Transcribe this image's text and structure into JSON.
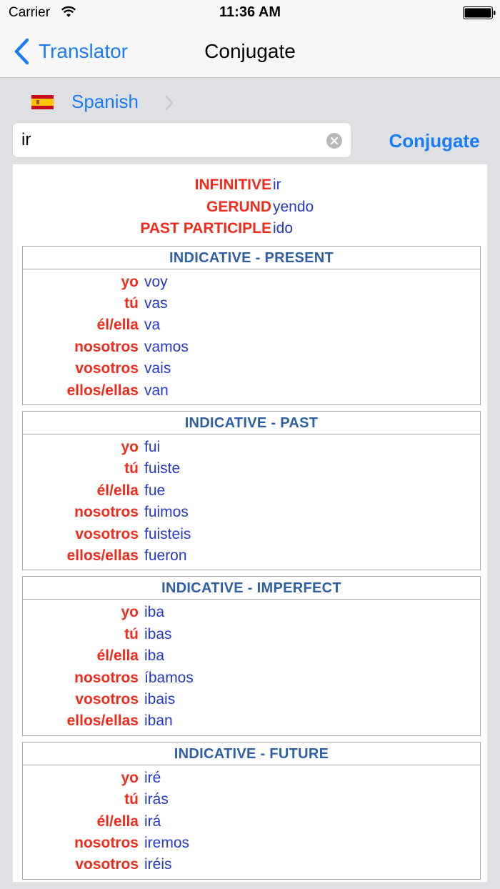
{
  "status": {
    "carrier": "Carrier",
    "time": "11:36 AM"
  },
  "nav": {
    "back_label": "Translator",
    "title": "Conjugate"
  },
  "language": {
    "name": "Spanish"
  },
  "search": {
    "value": "ir",
    "placeholder": ""
  },
  "conjugate_button": "Conjugate",
  "forms": [
    {
      "label": "INFINITIVE",
      "value": "ir"
    },
    {
      "label": "GERUND",
      "value": "yendo"
    },
    {
      "label": "PAST PARTICIPLE",
      "value": "ido"
    }
  ],
  "tenses": [
    {
      "title": "INDICATIVE - PRESENT",
      "rows": [
        {
          "pronoun": "yo",
          "form": "voy"
        },
        {
          "pronoun": "tú",
          "form": "vas"
        },
        {
          "pronoun": "él/ella",
          "form": "va"
        },
        {
          "pronoun": "nosotros",
          "form": "vamos"
        },
        {
          "pronoun": "vosotros",
          "form": "vais"
        },
        {
          "pronoun": "ellos/ellas",
          "form": "van"
        }
      ]
    },
    {
      "title": "INDICATIVE - PAST",
      "rows": [
        {
          "pronoun": "yo",
          "form": "fui"
        },
        {
          "pronoun": "tú",
          "form": "fuiste"
        },
        {
          "pronoun": "él/ella",
          "form": "fue"
        },
        {
          "pronoun": "nosotros",
          "form": "fuimos"
        },
        {
          "pronoun": "vosotros",
          "form": "fuisteis"
        },
        {
          "pronoun": "ellos/ellas",
          "form": "fueron"
        }
      ]
    },
    {
      "title": "INDICATIVE - IMPERFECT",
      "rows": [
        {
          "pronoun": "yo",
          "form": "iba"
        },
        {
          "pronoun": "tú",
          "form": "ibas"
        },
        {
          "pronoun": "él/ella",
          "form": "iba"
        },
        {
          "pronoun": "nosotros",
          "form": "íbamos"
        },
        {
          "pronoun": "vosotros",
          "form": "ibais"
        },
        {
          "pronoun": "ellos/ellas",
          "form": "iban"
        }
      ]
    },
    {
      "title": "INDICATIVE - FUTURE",
      "rows": [
        {
          "pronoun": "yo",
          "form": "iré"
        },
        {
          "pronoun": "tú",
          "form": "irás"
        },
        {
          "pronoun": "él/ella",
          "form": "irá"
        },
        {
          "pronoun": "nosotros",
          "form": "iremos"
        },
        {
          "pronoun": "vosotros",
          "form": "iréis"
        }
      ]
    }
  ],
  "colors": {
    "accent": "#1a7cf5",
    "label_red": "#ef2c1c",
    "value_blue": "#2538c8",
    "header_blue": "#2e5fa5"
  },
  "icons": [
    "wifi-icon",
    "battery-icon",
    "chevron-left-icon",
    "spain-flag-icon",
    "chevron-right-icon",
    "clear-icon"
  ]
}
